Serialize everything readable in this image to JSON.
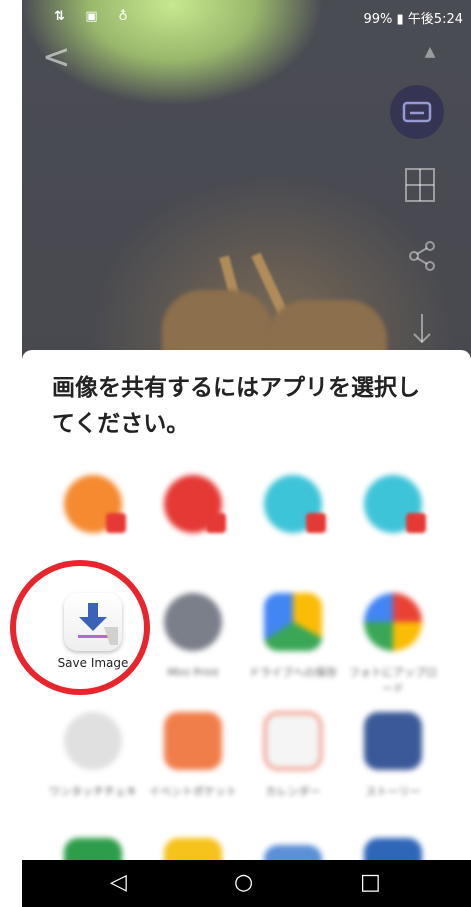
{
  "status_bar": {
    "left_icons": "⇅ ▣ ♁",
    "right_text": "99% ▮ 午後5:24"
  },
  "share_sheet": {
    "title": "画像を共有するにはアプリを選択してください。",
    "featured_app": {
      "label": "Save Image"
    },
    "blurred_apps_row2": [
      {
        "label": "Mini Print",
        "color": "#7b7f8a"
      },
      {
        "label": "ドライブへの保存",
        "color": "#3aa757"
      },
      {
        "label": "フォトにアップロード",
        "color": "#e94235"
      }
    ],
    "blurred_apps_row3": [
      {
        "label": "ワンタッチチェキ",
        "color": "#d0d0d0"
      },
      {
        "label": "イベントポケット",
        "color": "#f07e4a"
      },
      {
        "label": "カレンダー",
        "color": "#f2f2f2"
      },
      {
        "label": "ストーリー",
        "color": "#3b5998"
      }
    ]
  },
  "colors": {
    "highlight_circle": "#e8242c",
    "sheet_bg": "#ffffff",
    "nav_bar": "#000000"
  }
}
